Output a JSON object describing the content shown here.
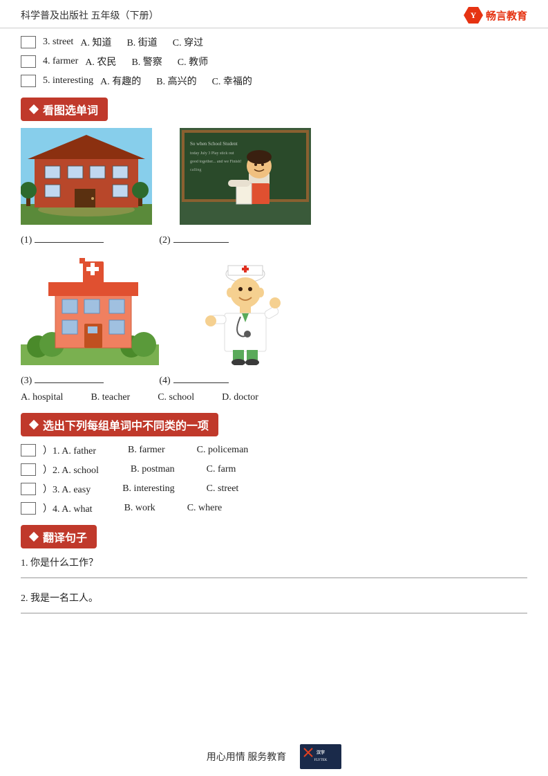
{
  "header": {
    "title": "科学普及出版社  五年级（下册）",
    "logo_text": "畅言教育"
  },
  "vocab_section": {
    "items": [
      {
        "num": "3. street",
        "options": [
          "A. 知道",
          "B. 街道",
          "C. 穿过"
        ]
      },
      {
        "num": "4. farmer",
        "options": [
          "A. 农民",
          "B. 警察",
          "C. 教师"
        ]
      },
      {
        "num": "5. interesting",
        "options": [
          "A. 有趣的",
          "B. 高兴的",
          "C. 幸福的"
        ]
      }
    ]
  },
  "section2": {
    "title": "看图选单词",
    "captions": [
      "(1)",
      "(2)",
      "(3)",
      "(4)"
    ],
    "options": [
      "A. hospital",
      "B. teacher",
      "C. school",
      "D. doctor"
    ]
  },
  "section3": {
    "title": "选出下列每组单词中不同类的一项",
    "items": [
      {
        "num": "1.",
        "options": [
          "A. father",
          "B. farmer",
          "C. policeman"
        ]
      },
      {
        "num": "2.",
        "options": [
          "A. school",
          "B. postman",
          "C. farm"
        ]
      },
      {
        "num": "3.",
        "options": [
          "A. easy",
          "B. interesting",
          "C. street"
        ]
      },
      {
        "num": "4.",
        "options": [
          "A. what",
          "B. work",
          "C. where"
        ]
      }
    ]
  },
  "section4": {
    "title": "翻译句子",
    "items": [
      "1. 你是什么工作？",
      "2. 我是一名工人。"
    ]
  },
  "footer": {
    "text": "用心用情  服务教育"
  }
}
